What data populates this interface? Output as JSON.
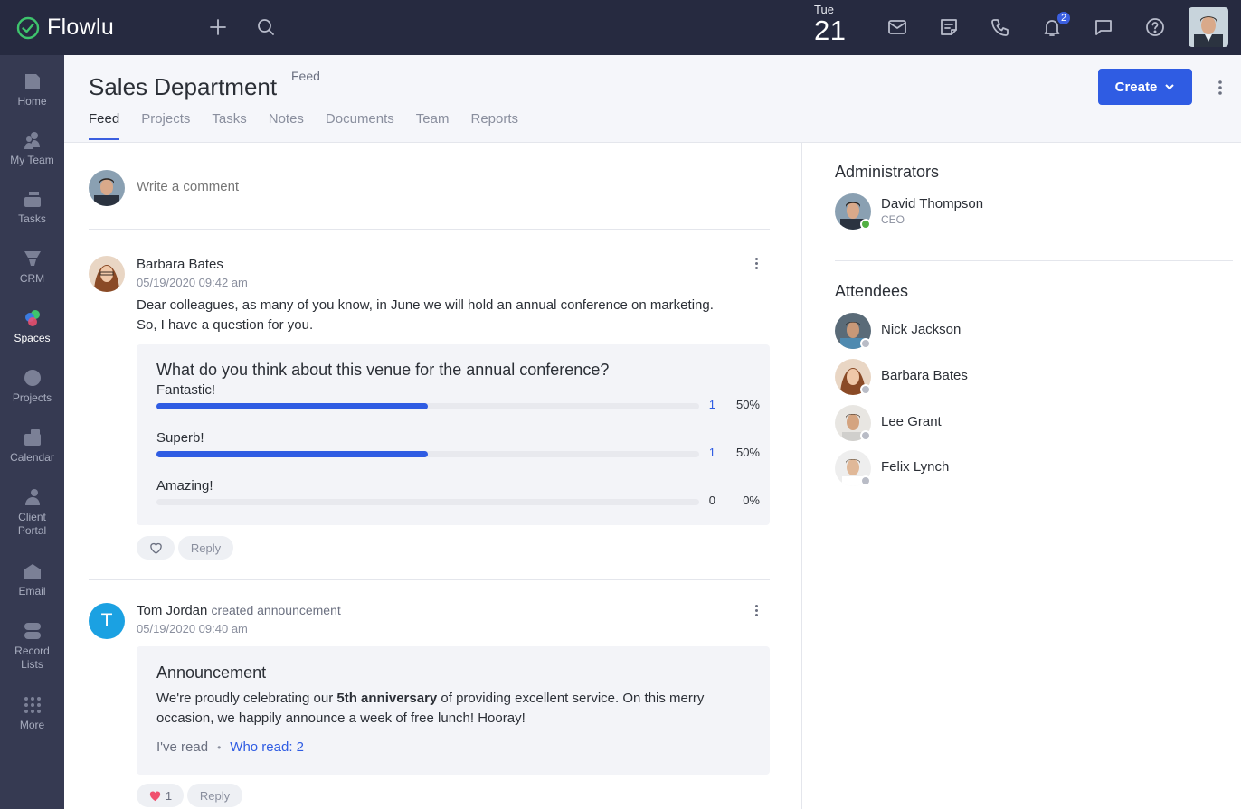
{
  "app": {
    "name": "Flowlu"
  },
  "topbar": {
    "day_of_week": "Tue",
    "day": "21",
    "notification_count": "2"
  },
  "sidebar": {
    "items": [
      {
        "label": "Home"
      },
      {
        "label": "My Team"
      },
      {
        "label": "Tasks"
      },
      {
        "label": "CRM"
      },
      {
        "label": "Spaces"
      },
      {
        "label": "Projects"
      },
      {
        "label": "Calendar"
      },
      {
        "label": "Client Portal"
      },
      {
        "label": "Email"
      },
      {
        "label": "Record Lists"
      },
      {
        "label": "More"
      }
    ]
  },
  "header": {
    "title": "Sales Department",
    "superscript": "Feed",
    "create_label": "Create",
    "tabs": [
      {
        "label": "Feed"
      },
      {
        "label": "Projects"
      },
      {
        "label": "Tasks"
      },
      {
        "label": "Notes"
      },
      {
        "label": "Documents"
      },
      {
        "label": "Team"
      },
      {
        "label": "Reports"
      }
    ]
  },
  "comment": {
    "placeholder": "Write a comment"
  },
  "posts": [
    {
      "author": "Barbara Bates",
      "date": "05/19/2020 09:42 am",
      "text": "Dear colleagues, as many of you know, in June we will hold an annual conference on marketing. So, I have a question for you.",
      "poll": {
        "question": "What do you think about this venue for the annual conference?",
        "options": [
          {
            "label": "Fantastic!",
            "count": "1",
            "percent": "50%",
            "fraction": 0.5
          },
          {
            "label": "Superb!",
            "count": "1",
            "percent": "50%",
            "fraction": 0.5
          },
          {
            "label": "Amazing!",
            "count": "0",
            "percent": "0%",
            "fraction": 0
          }
        ]
      },
      "reply_label": "Reply"
    },
    {
      "author": "Tom Jordan",
      "action": "created announcement",
      "avatar_initial": "T",
      "date": "05/19/2020 09:40 am",
      "announcement": {
        "title": "Announcement",
        "text_before": "We're proudly celebrating our ",
        "text_bold": "5th anniversary",
        "text_after": " of providing excellent service. On this merry occasion, we happily announce a week of free lunch! Hooray!",
        "ive_read": "I've read",
        "separator": "•",
        "who_read": "Who read: 2"
      },
      "like_count": "1",
      "reply_label": "Reply"
    }
  ],
  "right_panel": {
    "administrators_heading": "Administrators",
    "administrators": [
      {
        "name": "David Thompson",
        "role": "CEO",
        "status": "online"
      }
    ],
    "attendees_heading": "Attendees",
    "attendees": [
      {
        "name": "Nick Jackson",
        "status": "offline"
      },
      {
        "name": "Barbara Bates",
        "status": "offline"
      },
      {
        "name": "Lee Grant",
        "status": "offline"
      },
      {
        "name": "Felix Lynch",
        "status": "offline"
      }
    ]
  },
  "colors": {
    "topbar": "#262a40",
    "sidebar": "#363a52",
    "accent": "#2f5ce3",
    "online": "#52b043",
    "offline": "#b9bcc6",
    "like": "#f0506e",
    "tom_avatar": "#1ba1e2"
  }
}
